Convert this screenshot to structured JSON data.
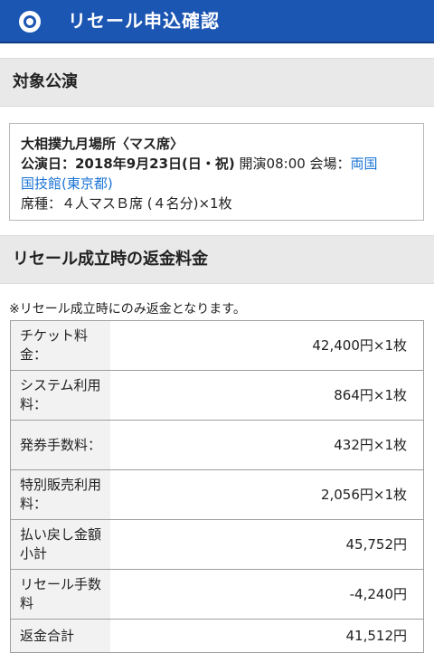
{
  "header": {
    "title": "リセール申込確認"
  },
  "section1": {
    "title": "対象公演"
  },
  "event": {
    "name": "大相撲九月場所〈マス席〉",
    "date_label": "公演日：2018年9月23日(日・祝)",
    "start_text": " 開演08:00 会場：",
    "venue_part1": "両国",
    "venue_part2": "国技館(東京都)",
    "seat": "席種：４人マスＢ席 (４名分)×1枚"
  },
  "section2": {
    "title": "リセール成立時の返金料金"
  },
  "note": "※リセール成立時にのみ返金となります。",
  "fees": [
    {
      "label": "チケット料金：",
      "value": "42,400円×1枚"
    },
    {
      "label": "システム利用料：",
      "value": "864円×1枚"
    },
    {
      "label": "発券手数料：",
      "value": "432円×1枚"
    },
    {
      "label": "特別販売利用料：",
      "value": "2,056円×1枚"
    },
    {
      "label": "払い戻し金額小計",
      "value": "45,752円"
    },
    {
      "label": "リセール手数料",
      "value": "-4,240円"
    },
    {
      "label": "返金合計",
      "value": "41,512円"
    }
  ],
  "colors": {
    "header_bg": "#1c56b3",
    "link": "#1a73d6",
    "section_bg": "#e9e9e9"
  },
  "icons": {
    "logo": "circle-logo-icon"
  }
}
